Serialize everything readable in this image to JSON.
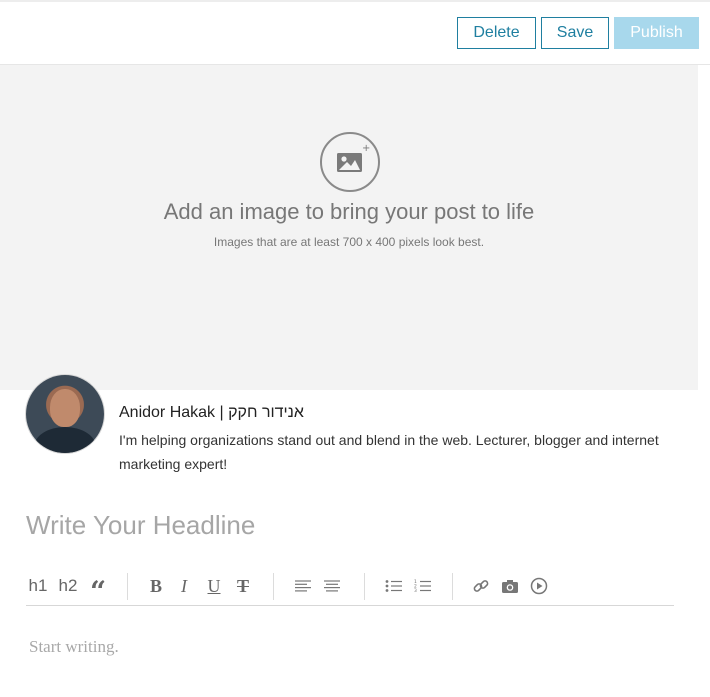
{
  "toolbar": {
    "delete_label": "Delete",
    "save_label": "Save",
    "publish_label": "Publish"
  },
  "image_upload": {
    "title": "Add an image to bring your post to life",
    "subtitle": "Images that are at least 700 x 400 pixels look best."
  },
  "author": {
    "name": "Anidor Hakak | אנידור חקק",
    "bio": "I'm helping organizations stand out and blend in the web. Lecturer, blogger and internet marketing expert!"
  },
  "editor": {
    "headline_placeholder": "Write Your Headline",
    "body_placeholder": "Start writing."
  },
  "format_toolbar": {
    "h1": "h1",
    "h2": "h2",
    "quote": "“",
    "bold": "B",
    "italic": "I",
    "underline": "U",
    "strike": "T"
  },
  "colors": {
    "accent": "#1f7fa0",
    "publish_disabled": "#a8d8ec",
    "image_area_bg": "#f3f3f3"
  }
}
